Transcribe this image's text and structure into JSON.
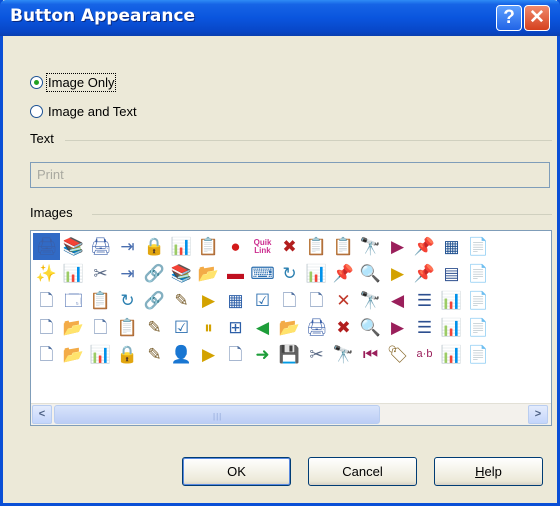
{
  "window": {
    "title": "Button Appearance"
  },
  "titlebar_buttons": {
    "help": "?",
    "close": "✕"
  },
  "radio_options": [
    {
      "label": "Image Only",
      "checked": true
    },
    {
      "label": "Image and Text",
      "checked": false
    }
  ],
  "text_group": {
    "label": "Text",
    "value": "Print"
  },
  "images_group": {
    "label": "Images"
  },
  "images": {
    "selected_index": 0,
    "icons": [
      [
        "printer",
        "book",
        "printer",
        "indent",
        "lock",
        "chart",
        "copy",
        "record",
        "quik-link",
        "cancel",
        "copy",
        "copy",
        "binoculars",
        "next",
        "paste",
        "form",
        "doc"
      ],
      [
        "new",
        "chart",
        "scissors",
        "indent",
        "link",
        "book",
        "folder",
        "dash",
        "code",
        "refresh",
        "chart",
        "paste",
        "find",
        "play",
        "paste",
        "table",
        "doc"
      ],
      [
        "page",
        "window",
        "copy",
        "refresh",
        "link",
        "pencil",
        "play",
        "grid",
        "check",
        "page",
        "page",
        "close",
        "binoculars",
        "prev",
        "list",
        "chart",
        "doc"
      ],
      [
        "page",
        "folder",
        "page",
        "copy",
        "pencil",
        "check",
        "pause",
        "tree",
        "back",
        "folder",
        "printer",
        "cancel",
        "find",
        "next",
        "list",
        "chart",
        "doc"
      ],
      [
        "page",
        "folder",
        "chart",
        "lock",
        "pencil",
        "user",
        "play",
        "page",
        "forward",
        "save",
        "scissors",
        "binoculars",
        "first",
        "tag",
        "a-b",
        "chart",
        "doc"
      ]
    ]
  },
  "icon_glyphs": {
    "printer": "🖨",
    "book": "📚",
    "indent": "⇥",
    "lock": "🔒",
    "chart": "📊",
    "copy": "📋",
    "record": "●",
    "quik-link": "Quik Link",
    "cancel": "✖",
    "paste": "📌",
    "form": "▦",
    "doc": "📄",
    "binoculars": "🔭",
    "next": "▶",
    "new": "✨",
    "scissors": "✂",
    "link": "🔗",
    "folder": "📂",
    "dash": "▬",
    "code": "⌨",
    "refresh": "↻",
    "find": "🔍",
    "play": "▶",
    "table": "▤",
    "page": "🗋",
    "window": "🗔",
    "pencil": "✎",
    "grid": "▦",
    "check": "☑",
    "close": "✕",
    "prev": "◀",
    "list": "☰",
    "pause": "⏸",
    "tree": "⊞",
    "back": "◀",
    "user": "👤",
    "forward": "➜",
    "save": "💾",
    "first": "⏮",
    "tag": "🏷",
    "a-b": "a·b"
  },
  "icon_colors": {
    "printer": "#3a5fa8",
    "book": "#c03b2b",
    "indent": "#4a6fb0",
    "lock": "#c89a1a",
    "chart": "#3c7a2e",
    "copy": "#3a5fa8",
    "record": "#d21a1a",
    "quik-link": "#cc2d8f",
    "cancel": "#b21e1e",
    "paste": "#8a6b2e",
    "form": "#1d4f8f",
    "doc": "#2d4f8f",
    "binoculars": "#222222",
    "next": "#9a1f5b",
    "new": "#c89a1a",
    "scissors": "#5a6a86",
    "link": "#3a5fa8",
    "folder": "#d8a21c",
    "dash": "#c01020",
    "code": "#2d6fb0",
    "refresh": "#2a7fb0",
    "find": "#333333",
    "play": "#d3a200",
    "table": "#2d4f8f",
    "page": "#4f6fa0",
    "window": "#3a5fa8",
    "pencil": "#7a5f2e",
    "grid": "#2d5fa8",
    "check": "#2d6fb0",
    "close": "#c0392b",
    "prev": "#9a1f5b",
    "list": "#2d4f8f",
    "pause": "#d3a200",
    "tree": "#2d5fa8",
    "back": "#1e9e3a",
    "user": "#a0522d",
    "forward": "#1e9e3a",
    "save": "#1d1d4f",
    "first": "#9a1f5b",
    "tag": "#8a6b2e",
    "a-b": "#9a1f5b"
  },
  "scrollbar": {
    "left_arrow": "<",
    "right_arrow": ">",
    "grip": "|||"
  },
  "buttons": {
    "ok": "OK",
    "cancel": "Cancel",
    "help_first": "H",
    "help_rest": "elp"
  }
}
